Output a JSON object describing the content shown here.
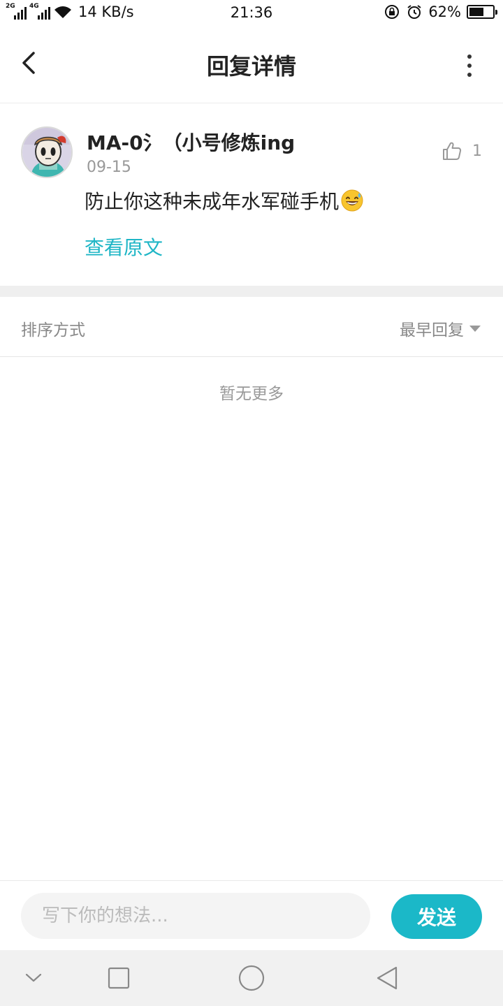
{
  "status_bar": {
    "network_1": "2G",
    "network_2": "4G",
    "speed": "14 KB/s",
    "time": "21:36",
    "battery_percent_text": "62%",
    "battery_level": 0.62,
    "icons": [
      "signal-icon",
      "wifi-icon",
      "rotation-lock-icon",
      "alarm-icon",
      "battery-icon"
    ]
  },
  "header": {
    "title": "回复详情",
    "back_icon": "chevron-left-icon",
    "more_icon": "more-vertical-icon"
  },
  "comment": {
    "username": "MA-0氵（小号修炼ing",
    "date": "09-15",
    "text": "防止你这种未成年水军碰手机",
    "emoji": "sweat-smile-emoji",
    "view_original": "查看原文",
    "like_count": "1",
    "like_icon": "thumbs-up-icon"
  },
  "sort": {
    "label": "排序方式",
    "selected": "最早回复"
  },
  "list": {
    "empty_text": "暂无更多"
  },
  "reply_bar": {
    "placeholder": "写下你的想法...",
    "value": "",
    "send_label": "发送"
  },
  "nav_bar": {
    "icons": [
      "chevron-down-icon",
      "recents-icon",
      "home-icon",
      "back-triangle-icon"
    ]
  },
  "colors": {
    "accent": "#1bb8c8",
    "link": "#1fb6c6",
    "secondary_text": "#999999"
  }
}
